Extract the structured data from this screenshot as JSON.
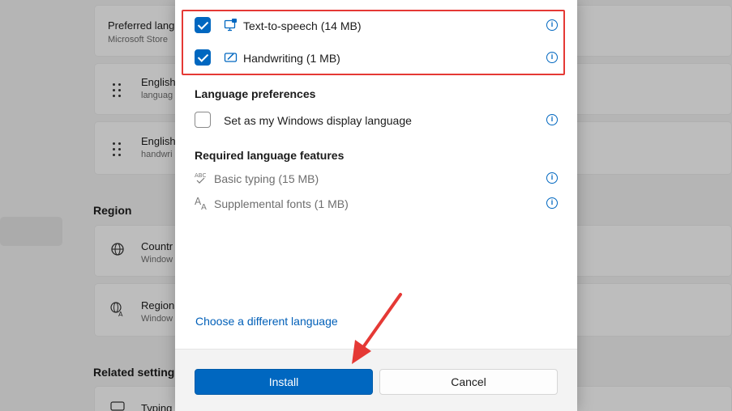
{
  "background": {
    "cards": [
      {
        "title": "Preferred lang",
        "subtitle": "Microsoft Store"
      },
      {
        "title": "English",
        "subtitle": "languag"
      },
      {
        "title": "English",
        "subtitle": "handwri"
      },
      {
        "title": "Countr",
        "subtitle": "Window"
      },
      {
        "title": "Region",
        "subtitle": "Window"
      },
      {
        "title": "Typing",
        "subtitle": ""
      }
    ],
    "headings": {
      "region": "Region",
      "related": "Related settings"
    }
  },
  "dialog": {
    "optional_features": [
      {
        "label": "Text-to-speech (14 MB)",
        "checked": true,
        "icon": "text-to-speech-icon"
      },
      {
        "label": "Handwriting (1 MB)",
        "checked": true,
        "icon": "handwriting-icon"
      }
    ],
    "language_preferences": {
      "title": "Language preferences",
      "display_language": {
        "label": "Set as my Windows display language",
        "checked": false
      }
    },
    "required_features": {
      "title": "Required language features",
      "items": [
        {
          "label": "Basic typing (15 MB)",
          "icon": "basic-typing-icon"
        },
        {
          "label": "Supplemental fonts (1 MB)",
          "icon": "fonts-icon"
        }
      ]
    },
    "info_glyph": "i",
    "choose_link": "Choose a different language",
    "install_label": "Install",
    "cancel_label": "Cancel"
  },
  "colors": {
    "accent": "#0067c0",
    "highlight": "#e53935",
    "link": "#005fb8"
  }
}
